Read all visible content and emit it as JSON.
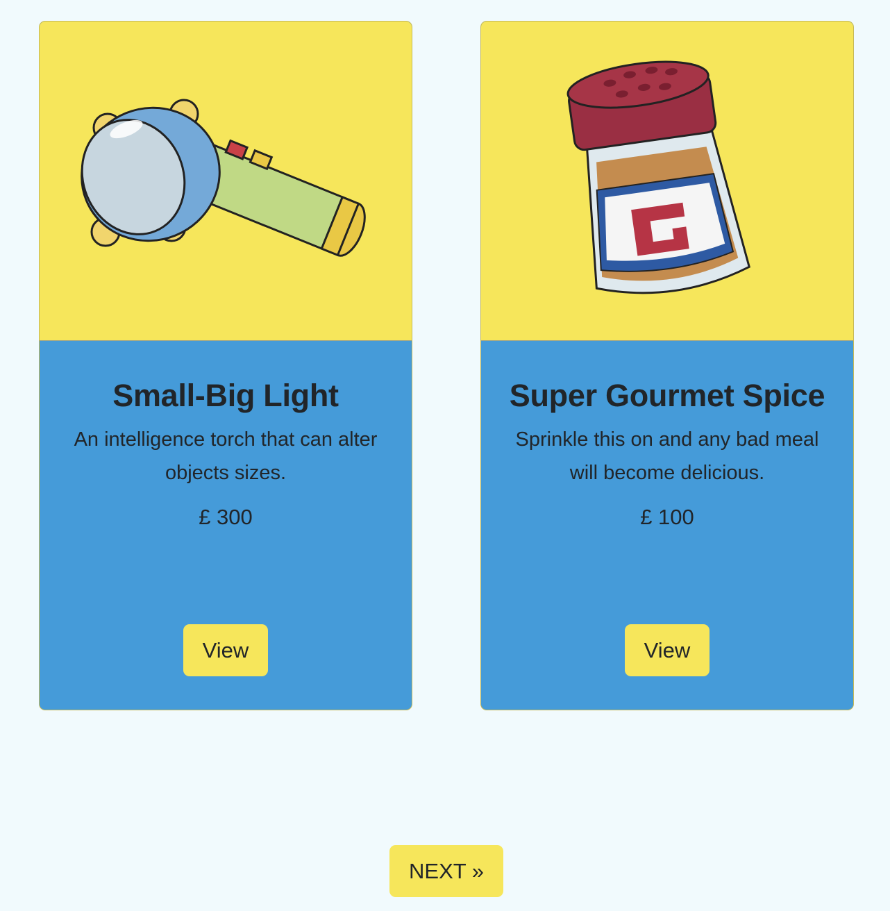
{
  "products": [
    {
      "name": "Small-Big Light",
      "description": "An intelligence torch that can alter objects sizes.",
      "price": "£ 300",
      "image_icon": "torch-icon",
      "view_label": "View"
    },
    {
      "name": "Super Gourmet Spice",
      "description": "Sprinkle this on and any bad meal will become delicious.",
      "price": "£ 100",
      "image_icon": "spice-shaker-icon",
      "view_label": "View"
    }
  ],
  "pagination": {
    "next_label": "NEXT »"
  },
  "colors": {
    "page_background": "#f1fafd",
    "card_image_background": "#f6e65b",
    "card_body_background": "#459bd9",
    "button_background": "#f6e65b",
    "text": "#212529"
  }
}
